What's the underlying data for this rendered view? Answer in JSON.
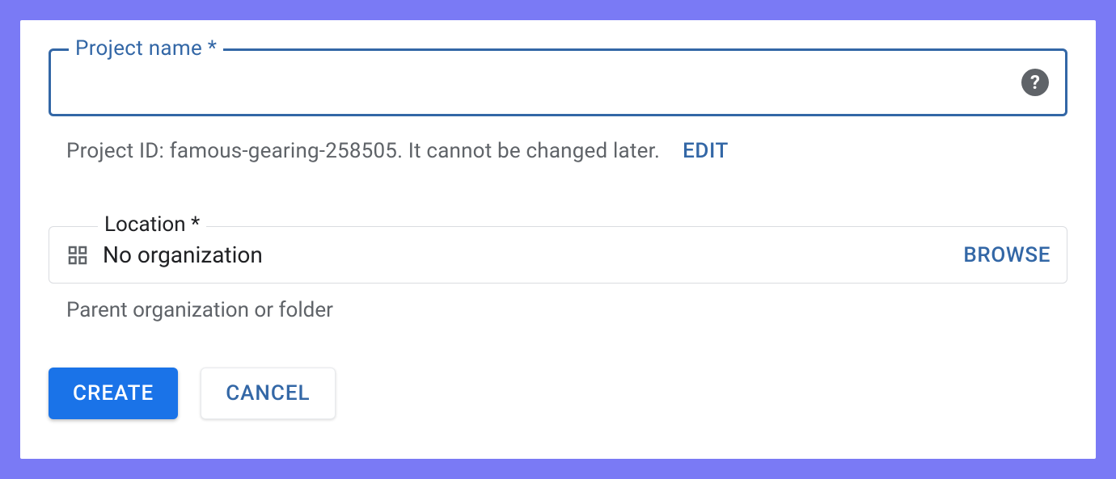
{
  "projectName": {
    "label": "Project name *",
    "value": ""
  },
  "projectId": {
    "hint": "Project ID: famous-gearing-258505. It cannot be changed later.",
    "editLabel": "EDIT"
  },
  "location": {
    "label": "Location *",
    "value": "No organization",
    "browseLabel": "BROWSE",
    "hint": "Parent organization or folder"
  },
  "buttons": {
    "create": "CREATE",
    "cancel": "CANCEL"
  }
}
